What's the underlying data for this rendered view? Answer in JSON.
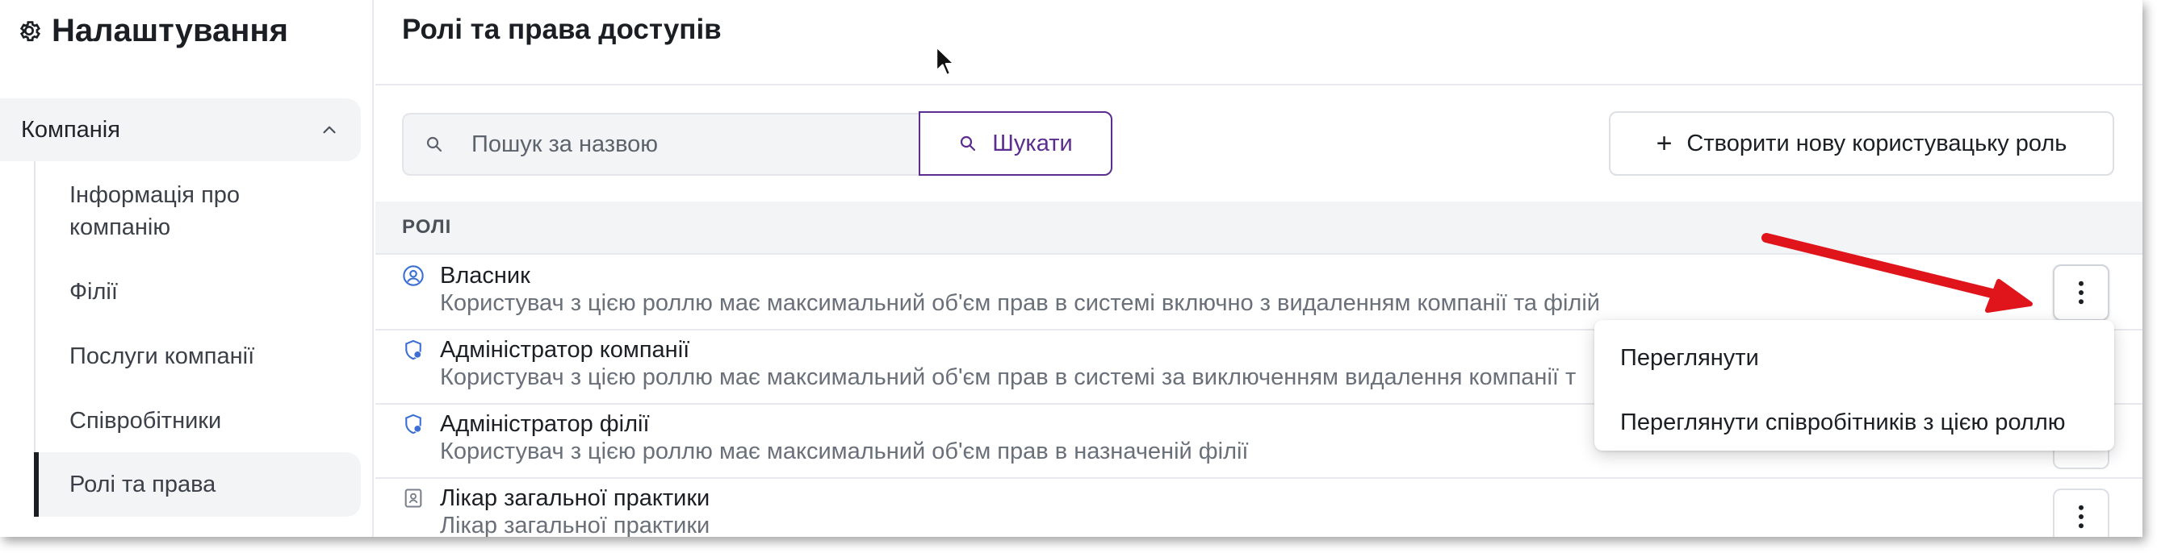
{
  "sidebar": {
    "title": "Налаштування",
    "section": "Компанія",
    "items": [
      {
        "label": "Інформація про компанію"
      },
      {
        "label": "Філії"
      },
      {
        "label": "Послуги компанії"
      },
      {
        "label": "Співробітники"
      },
      {
        "label": "Ролі та права"
      }
    ]
  },
  "main": {
    "title": "Ролі та права доступів",
    "search": {
      "placeholder": "Пошук за назвою",
      "value": ""
    },
    "search_button": "Шукати",
    "create_button": "Створити нову користувацьку роль",
    "table_header": "РОЛІ",
    "roles": [
      {
        "name": "Власник",
        "description": "Користувач з цією роллю має максимальний об'єм прав в системі включно з видаленням компанії та філій",
        "icon": "user-circle-icon"
      },
      {
        "name": "Адміністратор компанії",
        "description": "Користувач з цією роллю має максимальний об'єм прав в системі за виключенням видалення компанії т",
        "icon": "shield-user-icon"
      },
      {
        "name": "Адміністратор філії",
        "description": "Користувач з цією роллю має максимальний об'єм прав в назначеній філії",
        "icon": "shield-user-icon"
      },
      {
        "name": "Лікар загальної практики",
        "description": "Лікар загальної практики",
        "icon": "id-badge-icon"
      }
    ]
  },
  "dropdown": {
    "items": [
      {
        "label": "Переглянути"
      },
      {
        "label": "Переглянути співробітників з цією роллю"
      }
    ]
  },
  "colors": {
    "accent": "#5b2d8e",
    "sidebar_active_bg": "#f3f4f6",
    "annotation_arrow": "#e0141b"
  }
}
